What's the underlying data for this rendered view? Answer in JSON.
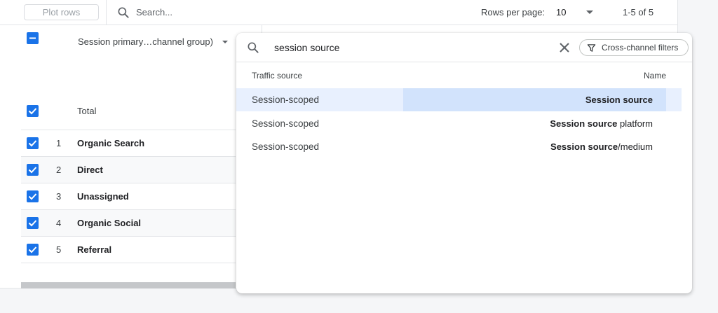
{
  "toolbar": {
    "plot_rows_label": "Plot rows",
    "search_placeholder": "Search...",
    "rows_per_page_label": "Rows per page:",
    "rows_per_page_value": "10",
    "range_label": "1-5 of 5"
  },
  "table": {
    "dimension_header": "Session primary…channel group)",
    "total_label": "Total",
    "rows": [
      {
        "index": "1",
        "name": "Organic Search"
      },
      {
        "index": "2",
        "name": "Direct"
      },
      {
        "index": "3",
        "name": "Unassigned"
      },
      {
        "index": "4",
        "name": "Organic Social"
      },
      {
        "index": "5",
        "name": "Referral"
      }
    ]
  },
  "popup": {
    "query": "session source",
    "cross_channel_label": "Cross-channel filters",
    "col_source": "Traffic source",
    "col_name": "Name",
    "results": [
      {
        "source": "Session-scoped",
        "name_bold": "Session source",
        "name_rest": ""
      },
      {
        "source": "Session-scoped",
        "name_bold": "Session source",
        "name_rest": " platform"
      },
      {
        "source": "Session-scoped",
        "name_bold": "Session source",
        "name_rest": "/medium"
      }
    ]
  },
  "colors": {
    "accent": "#1a73e8",
    "selected_row": "#e8f0fe"
  }
}
